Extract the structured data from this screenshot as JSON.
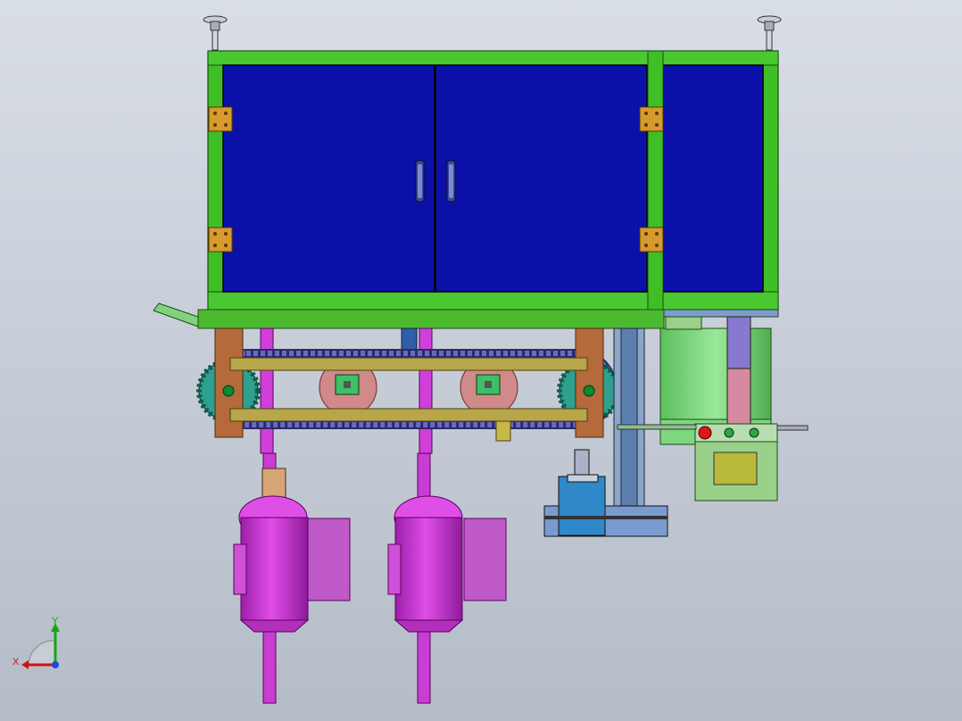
{
  "viewport": {
    "background_top": "#d9dee6",
    "background_bottom": "#b4bcc8"
  },
  "colors": {
    "frame_green": "#3fbf26",
    "panel_blue": "#0a10a8",
    "hinge_gold": "#d79a2e",
    "wood_brown": "#b46a3a",
    "rail_olive": "#b8a64a",
    "chain_purple": "#5a5aa8",
    "gear_teal": "#2f9f8f",
    "cam_pink": "#d08a8a",
    "spindle_magenta": "#c233cc",
    "cylinder_green": "#7fd77f",
    "column_slate": "#6f8fb8",
    "control_box_green": "#9ad08a",
    "button_red": "#e01515"
  },
  "triad": {
    "x_label": "X",
    "y_label": "Y"
  }
}
